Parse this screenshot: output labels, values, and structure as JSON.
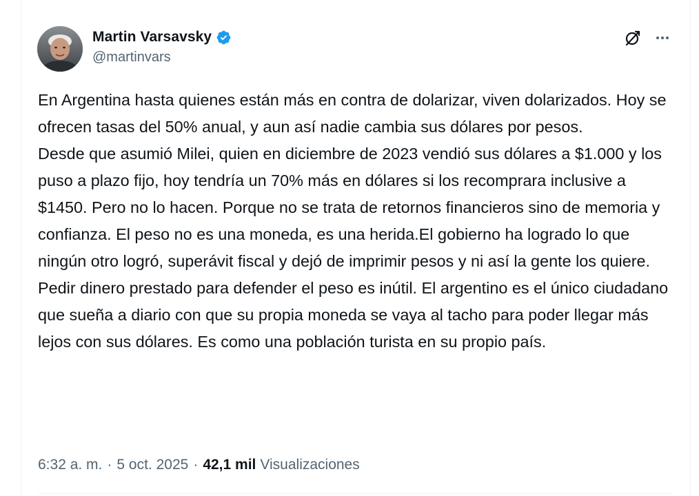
{
  "author": {
    "display_name": "Martin Varsavsky",
    "handle": "@martinvars",
    "verified_icon": "verified-badge-icon",
    "verified_color": "#1d9bf0"
  },
  "actions": {
    "grok_icon": "grok-icon",
    "more_icon": "more-options-icon"
  },
  "tweet": {
    "text": "En Argentina hasta quienes están más en contra de dolarizar, viven dolarizados. Hoy se ofrecen tasas del 50% anual, y aun así nadie cambia sus dólares por pesos.\nDesde que asumió Milei, quien en diciembre de 2023 vendió sus dólares a $1.000 y los puso a plazo fijo, hoy tendría un 70% más en dólares si los recomprara inclusive a $1450. Pero no lo hacen. Porque no se trata de retornos financieros sino de memoria y confianza. El peso no es una moneda, es una herida.El gobierno ha logrado lo que ningún otro logró, superávit fiscal y dejó de imprimir pesos y ni así la gente los quiere. Pedir dinero prestado para defender el peso es inútil. El argentino es el único ciudadano que sueña a diario con que su propia moneda se vaya al tacho para poder llegar más lejos con sus dólares. Es como una población turista en su propio país."
  },
  "meta": {
    "time": "6:32 a. m.",
    "separator": "·",
    "date": "5 oct. 2025",
    "views_count": "42,1 mil",
    "views_label": "Visualizaciones"
  },
  "colors": {
    "text_primary": "#0f1419",
    "text_secondary": "#536471",
    "border": "#eff3f4"
  }
}
